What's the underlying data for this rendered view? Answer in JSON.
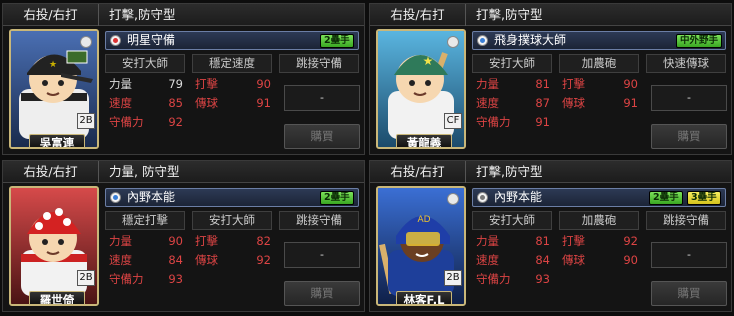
{
  "cards": [
    {
      "hand": "右投/右打",
      "player_type": "打擊,防守型",
      "name": "吳富連",
      "position": "2B",
      "skill": {
        "name": "明星守備",
        "icon": "red-ball-icon",
        "tags": [
          "2壘手"
        ]
      },
      "sub_skills": [
        "安打大師",
        "穩定速度",
        "跳接守備"
      ],
      "stats": [
        {
          "label": "力量",
          "value": "79",
          "color": "white"
        },
        {
          "label": "打擊",
          "value": "90",
          "color": "red"
        },
        {
          "label": "速度",
          "value": "85",
          "color": "red"
        },
        {
          "label": "傳球",
          "value": "91",
          "color": "red"
        },
        {
          "label": "守備力",
          "value": "92",
          "color": "red"
        }
      ],
      "dash": "-",
      "buy": "購買"
    },
    {
      "hand": "右投/右打",
      "player_type": "打擊,防守型",
      "name": "黃龍義",
      "position": "CF",
      "skill": {
        "name": "飛身撲球大師",
        "icon": "blue-ball-icon",
        "tags": [
          "中外野手"
        ]
      },
      "sub_skills": [
        "安打大師",
        "加農砲",
        "快速傳球"
      ],
      "stats": [
        {
          "label": "力量",
          "value": "81",
          "color": "red"
        },
        {
          "label": "打擊",
          "value": "90",
          "color": "red"
        },
        {
          "label": "速度",
          "value": "87",
          "color": "red"
        },
        {
          "label": "傳球",
          "value": "91",
          "color": "red"
        },
        {
          "label": "守備力",
          "value": "91",
          "color": "red"
        }
      ],
      "dash": "-",
      "buy": "購買"
    },
    {
      "hand": "右投/右打",
      "player_type": "力量, 防守型",
      "name": "羅世倚",
      "position": "2B",
      "skill": {
        "name": "內野本能",
        "icon": "blue-ball-icon",
        "tags": [
          "2壘手"
        ]
      },
      "sub_skills": [
        "穩定打擊",
        "安打大師",
        "跳接守備"
      ],
      "stats": [
        {
          "label": "力量",
          "value": "90",
          "color": "red"
        },
        {
          "label": "打擊",
          "value": "82",
          "color": "red"
        },
        {
          "label": "速度",
          "value": "84",
          "color": "red"
        },
        {
          "label": "傳球",
          "value": "92",
          "color": "red"
        },
        {
          "label": "守備力",
          "value": "93",
          "color": "red"
        }
      ],
      "dash": "-",
      "buy": "購買"
    },
    {
      "hand": "右投/右打",
      "player_type": "打擊,防守型",
      "name": "林客F.L",
      "position": "2B",
      "skill": {
        "name": "內野本能",
        "icon": "gray-ball-icon",
        "tags": [
          "2壘手",
          "3壘手"
        ]
      },
      "sub_skills": [
        "安打大師",
        "加農砲",
        "跳接守備"
      ],
      "stats": [
        {
          "label": "力量",
          "value": "81",
          "color": "red"
        },
        {
          "label": "打擊",
          "value": "92",
          "color": "red"
        },
        {
          "label": "速度",
          "value": "84",
          "color": "red"
        },
        {
          "label": "傳球",
          "value": "90",
          "color": "red"
        },
        {
          "label": "守備力",
          "value": "93",
          "color": "red"
        }
      ],
      "dash": "-",
      "buy": "購買"
    }
  ],
  "colors": {
    "stat_red": "#dd4444",
    "frame_gold": "#c9b779",
    "tag_green": "#4fc22f",
    "tag_yellow": "#e0d12a"
  }
}
